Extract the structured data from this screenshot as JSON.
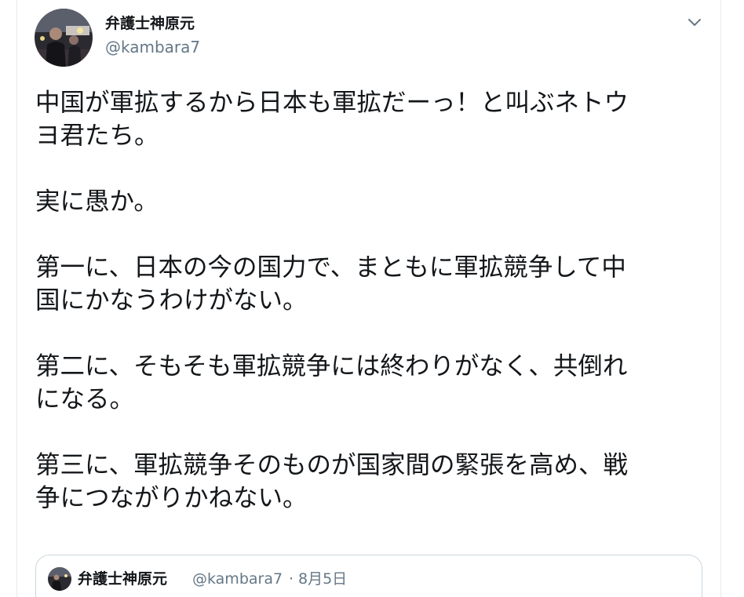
{
  "tweet": {
    "author": {
      "display_name": "弁護士神原元",
      "handle": "@kambara7",
      "avatar_icon": "user-avatar-photo"
    },
    "menu_icon": "chevron-down-icon",
    "paragraphs": [
      [
        "中国が軍拡するから日本も軍拡だーっ！と叫ぶネトウ",
        "ヨ君たち。"
      ],
      [
        "実に愚か。"
      ],
      [
        "第一に、日本の今の国力で、まともに軍拡競争して中",
        "国にかなうわけがない。"
      ],
      [
        "第二に、そもそも軍拡競争には終わりがなく、共倒れ",
        "になる。"
      ],
      [
        "第三に、軍拡競争そのものが国家間の緊張を高め、戦",
        "争につながりかねない。"
      ]
    ],
    "quoted": {
      "display_name": "弁護士神原元",
      "handle": "@kambara7",
      "separator": "·",
      "date": "8月5日"
    }
  },
  "colors": {
    "text_primary": "#14171a",
    "text_secondary": "#657786",
    "border": "#ccd6dd",
    "rail": "#e6ecf0"
  }
}
